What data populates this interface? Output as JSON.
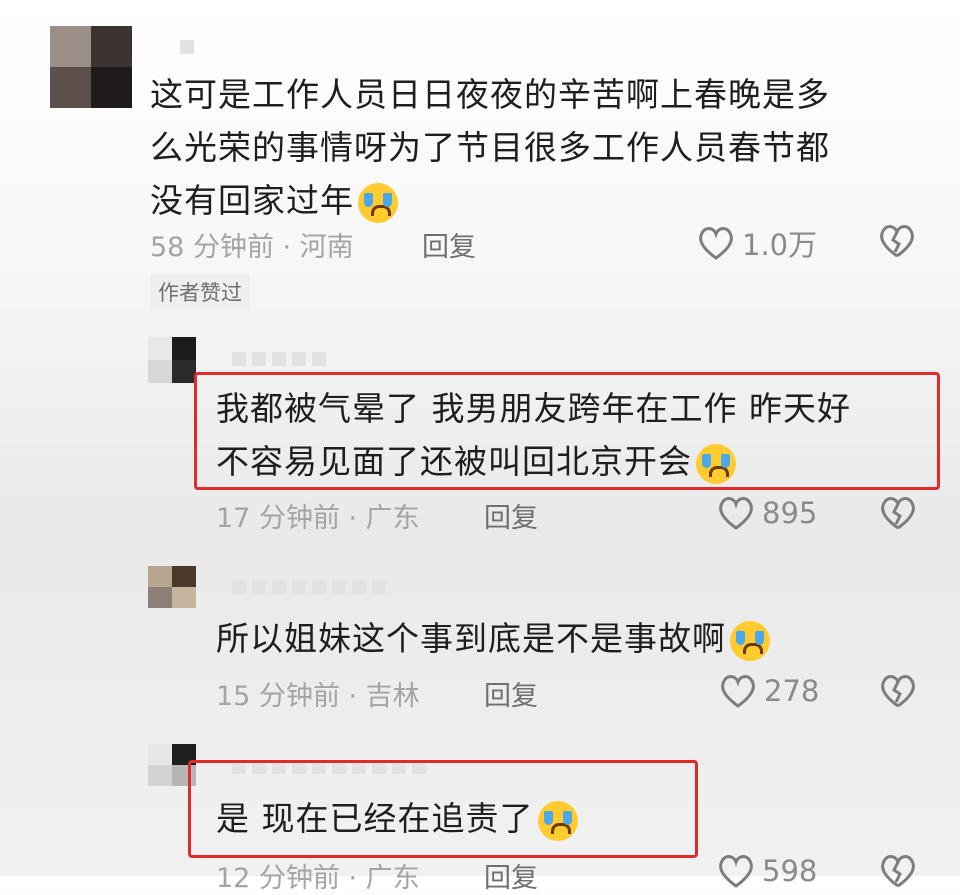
{
  "comments": [
    {
      "text_lines": [
        "这可是工作人员日日夜夜的辛苦啊上春晚是多",
        "么光荣的事情呀为了节目很多工作人员春节都",
        "没有回家过年"
      ],
      "time_location": "58 分钟前 · 河南",
      "reply_label": "回复",
      "likes": "1.0万",
      "badge": "作者赞过"
    },
    {
      "text_lines": [
        "我都被气晕了 我男朋友跨年在工作 昨天好",
        "不容易见面了还被叫回北京开会"
      ],
      "time_location": "17 分钟前 · 广东",
      "reply_label": "回复",
      "likes": "895"
    },
    {
      "text_lines": [
        "所以姐妹这个事到底是不是事故啊"
      ],
      "time_location": "15 分钟前 · 吉林",
      "reply_label": "回复",
      "likes": "278"
    },
    {
      "text_lines": [
        "是 现在已经在追责了"
      ],
      "time_location": "12 分钟前 · 广东",
      "reply_label": "回复",
      "likes": "598"
    }
  ],
  "icons": {
    "like": "heart-outline-icon",
    "dislike": "broken-heart-icon",
    "emoji": "crying-face-emoji"
  },
  "colors": {
    "highlight_border": "#e02b2b",
    "meta_text": "#a4a4a4",
    "body_text": "#1e1e1e"
  }
}
